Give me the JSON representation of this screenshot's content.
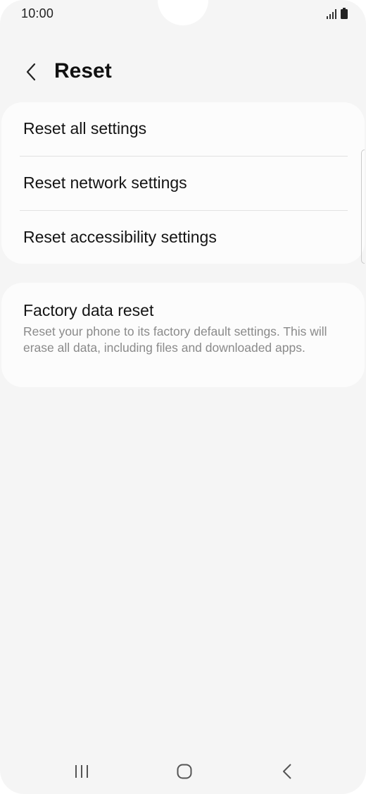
{
  "status_bar": {
    "time": "10:00",
    "icons": [
      "signal-icon",
      "battery-icon"
    ]
  },
  "header": {
    "title": "Reset",
    "back_icon": "chevron-left-icon"
  },
  "reset_options": {
    "items": [
      {
        "label": "Reset all settings"
      },
      {
        "label": "Reset network settings"
      },
      {
        "label": "Reset accessibility settings"
      }
    ]
  },
  "factory_reset": {
    "title": "Factory data reset",
    "description": "Reset your phone to its factory default settings. This will erase all data, including files and downloaded apps."
  },
  "nav_bar": {
    "buttons": [
      "recent-apps-icon",
      "home-icon",
      "back-icon"
    ]
  },
  "colors": {
    "background": "#f5f5f5",
    "card": "#fcfcfc",
    "primary_text": "#141414",
    "secondary_text": "#8a8a8a",
    "divider": "#e2e2e2"
  }
}
